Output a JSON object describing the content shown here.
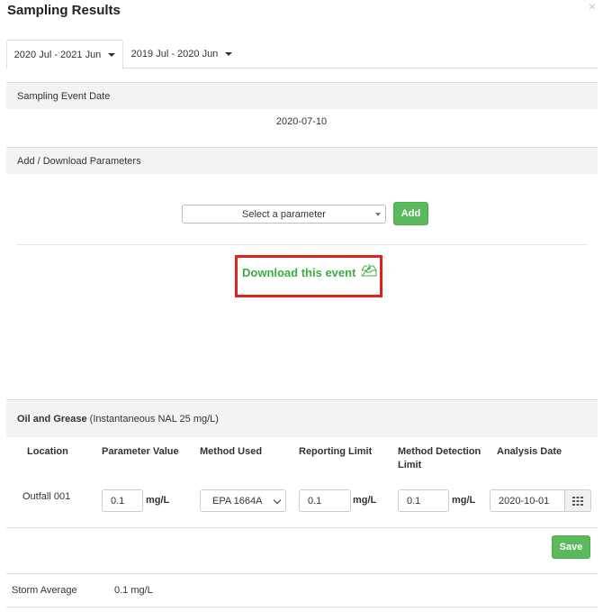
{
  "modal": {
    "title": "Sampling Results",
    "close_symbol": "×"
  },
  "tabs": [
    {
      "label": "2020 Jul - 2021 Jun",
      "active": true
    },
    {
      "label": "2019 Jul - 2020 Jun",
      "active": false
    }
  ],
  "sampling_event": {
    "header": "Sampling Event Date",
    "date": "2020-07-10"
  },
  "parameters": {
    "header": "Add / Download Parameters",
    "select_placeholder": "Select a parameter",
    "add_label": "Add",
    "download_label": "Download this event",
    "download_icon": "inbox-download-icon"
  },
  "parameter_block": {
    "name": "Oil and Grease",
    "detail": "(Instantaneous NAL 25 mg/L)",
    "columns": [
      "Location",
      "Parameter Value",
      "Method Used",
      "Reporting Limit",
      "Method Detection",
      "Limit",
      "Analysis Date"
    ],
    "row": {
      "location": "Outfall 001",
      "parameter_value": "0.1",
      "parameter_unit": "mg/L",
      "method": "EPA 1664A",
      "reporting_limit": "0.1",
      "reporting_unit": "mg/L",
      "mdl": "0.1",
      "mdl_unit": "mg/L",
      "analysis_date": "2020-10-01",
      "calendar_icon": "calendar-grid-icon"
    },
    "save_label": "Save"
  },
  "summary": {
    "label": "Storm Average",
    "value": "0.1 mg/L"
  },
  "colors": {
    "accent_green": "#5cb85c",
    "link_green": "#3cae3f",
    "highlight_red": "#e0231a"
  }
}
